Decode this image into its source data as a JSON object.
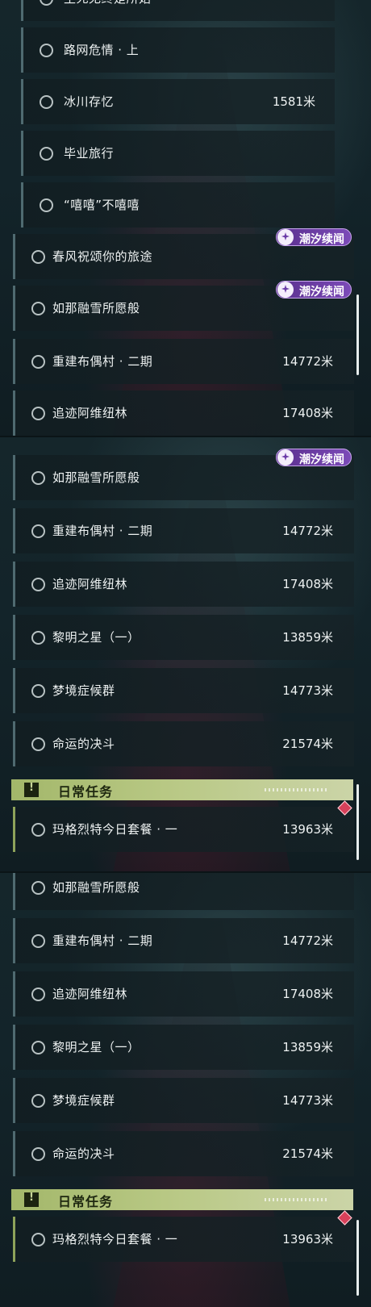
{
  "panel1": {
    "partial_top_label": "生死无终是所始",
    "items": [
      {
        "label": "路网危情 · 上",
        "distance": ""
      },
      {
        "label": "冰川存忆",
        "distance": "1581米"
      },
      {
        "label": "毕业旅行",
        "distance": ""
      },
      {
        "label": "“嘻嘻”不嘻嘻",
        "distance": ""
      },
      {
        "label": "春风祝颂你的旅途",
        "distance": ""
      },
      {
        "label": "如那融雪所愿般",
        "distance": ""
      },
      {
        "label": "重建布偶村 · 二期",
        "distance": "14772米"
      },
      {
        "label": "追迹阿维纽林",
        "distance": "17408米"
      }
    ],
    "badges": [
      "潮汐续闻",
      "潮汐续闻"
    ]
  },
  "panel2": {
    "badge": "潮汐续闻",
    "items": [
      {
        "label": "如那融雪所愿般",
        "distance": ""
      },
      {
        "label": "重建布偶村 · 二期",
        "distance": "14772米"
      },
      {
        "label": "追迹阿维纽林",
        "distance": "17408米"
      },
      {
        "label": "黎明之星（一）",
        "distance": "13859米"
      },
      {
        "label": "梦境症候群",
        "distance": "14773米"
      },
      {
        "label": "命运的决斗",
        "distance": "21574米"
      }
    ],
    "section_title": "日常任务",
    "section_icon": "!",
    "daily": {
      "label": "玛格烈特今日套餐 · 一",
      "distance": "13963米"
    }
  },
  "panel3": {
    "items": [
      {
        "label": "如那融雪所愿般",
        "distance": ""
      },
      {
        "label": "重建布偶村 · 二期",
        "distance": "14772米"
      },
      {
        "label": "追迹阿维纽林",
        "distance": "17408米"
      },
      {
        "label": "黎明之星（一）",
        "distance": "13859米"
      },
      {
        "label": "梦境症候群",
        "distance": "14773米"
      },
      {
        "label": "命运的决斗",
        "distance": "21574米"
      }
    ],
    "section_title": "日常任务",
    "section_icon": "!",
    "daily": {
      "label": "玛格烈特今日套餐 · 一",
      "distance": "13963米"
    }
  },
  "colors": {
    "quest_border": "#4f6a70",
    "daily_border": "#8ea35a",
    "badge_purple": "#6c3da8",
    "section_green": "#a3b76a",
    "diamond_red": "#d8405a"
  },
  "icons": {
    "radio": "radio-circle-icon",
    "badge": "sparkle-icon",
    "section": "exclamation-icon",
    "marker": "diamond-icon"
  }
}
